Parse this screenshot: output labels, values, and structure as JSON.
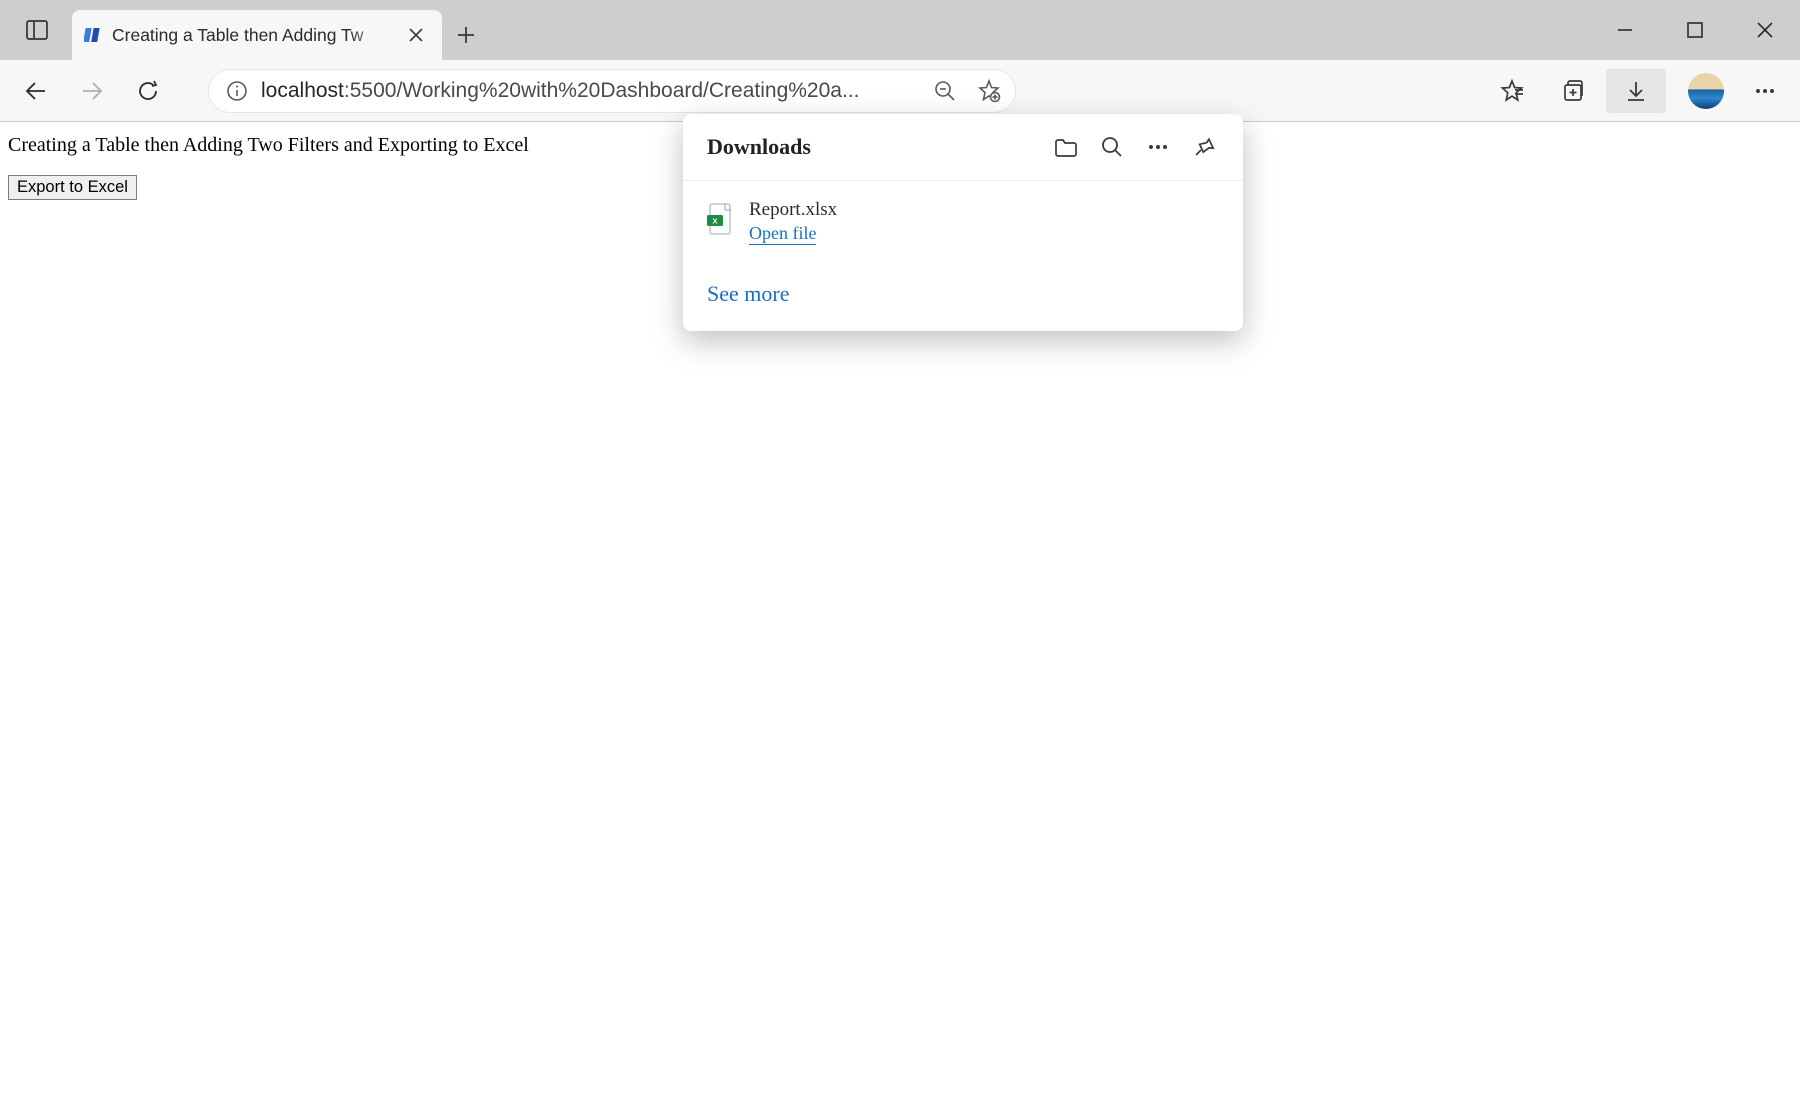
{
  "browser": {
    "tab_title": "Creating a Table then Adding Tw",
    "address_host": "localhost",
    "address_path": ":5500/Working%20with%20Dashboard/Creating%20a..."
  },
  "page": {
    "heading": "Creating a Table then Adding Two Filters and Exporting to Excel",
    "export_button": "Export to Excel"
  },
  "downloads": {
    "title": "Downloads",
    "file_name": "Report.xlsx",
    "open_label": "Open file",
    "see_more": "See more"
  }
}
